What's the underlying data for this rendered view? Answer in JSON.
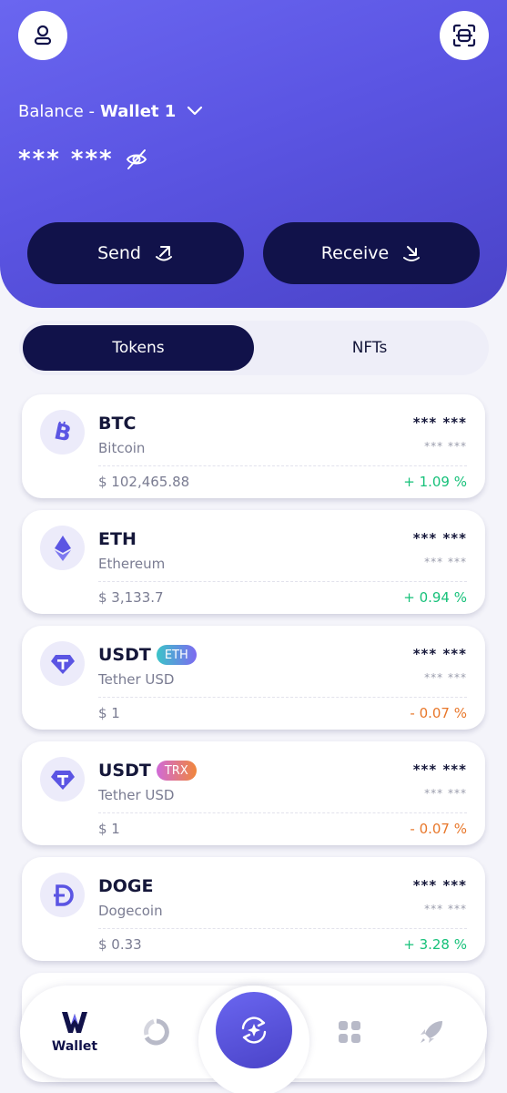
{
  "header": {
    "balance_label": "Balance -",
    "wallet_name": "Wallet 1",
    "masked_balance": "*** ***"
  },
  "actions": {
    "send_label": "Send",
    "receive_label": "Receive"
  },
  "tabs": [
    {
      "label": "Tokens",
      "active": true
    },
    {
      "label": "NFTs",
      "active": false
    }
  ],
  "tokens": [
    {
      "symbol": "BTC",
      "name": "Bitcoin",
      "chip": "",
      "masked_value": "*** ***",
      "masked_sub": "*** ***",
      "price": "$ 102,465.88",
      "change": "+ 1.09 %",
      "icon": "bitcoin-icon"
    },
    {
      "symbol": "ETH",
      "name": "Ethereum",
      "chip": "",
      "masked_value": "*** ***",
      "masked_sub": "*** ***",
      "price": "$ 3,133.7",
      "change": "+ 0.94 %",
      "icon": "ethereum-icon"
    },
    {
      "symbol": "USDT",
      "name": "Tether USD",
      "chip": "ETH",
      "masked_value": "*** ***",
      "masked_sub": "*** ***",
      "price": "$ 1",
      "change": "- 0.07 %",
      "icon": "tether-icon"
    },
    {
      "symbol": "USDT",
      "name": "Tether USD",
      "chip": "TRX",
      "masked_value": "*** ***",
      "masked_sub": "*** ***",
      "price": "$ 1",
      "change": "- 0.07 %",
      "icon": "tether-icon"
    },
    {
      "symbol": "DOGE",
      "name": "Dogecoin",
      "chip": "",
      "masked_value": "*** ***",
      "masked_sub": "*** ***",
      "price": "$ 0.33",
      "change": "+ 3.28 %",
      "icon": "dogecoin-icon"
    }
  ],
  "nav": {
    "wallet_label": "Wallet",
    "items": [
      "wallet-icon",
      "portfolio-icon",
      "swap-icon",
      "apps-icon",
      "rocket-icon"
    ]
  },
  "colors": {
    "accent": "#5b55e3",
    "dark": "#11124a",
    "positive": "#17c17a",
    "negative": "#e8772a",
    "chip_eth": "#3bc4c8",
    "chip_trx": "#d06ad8"
  }
}
